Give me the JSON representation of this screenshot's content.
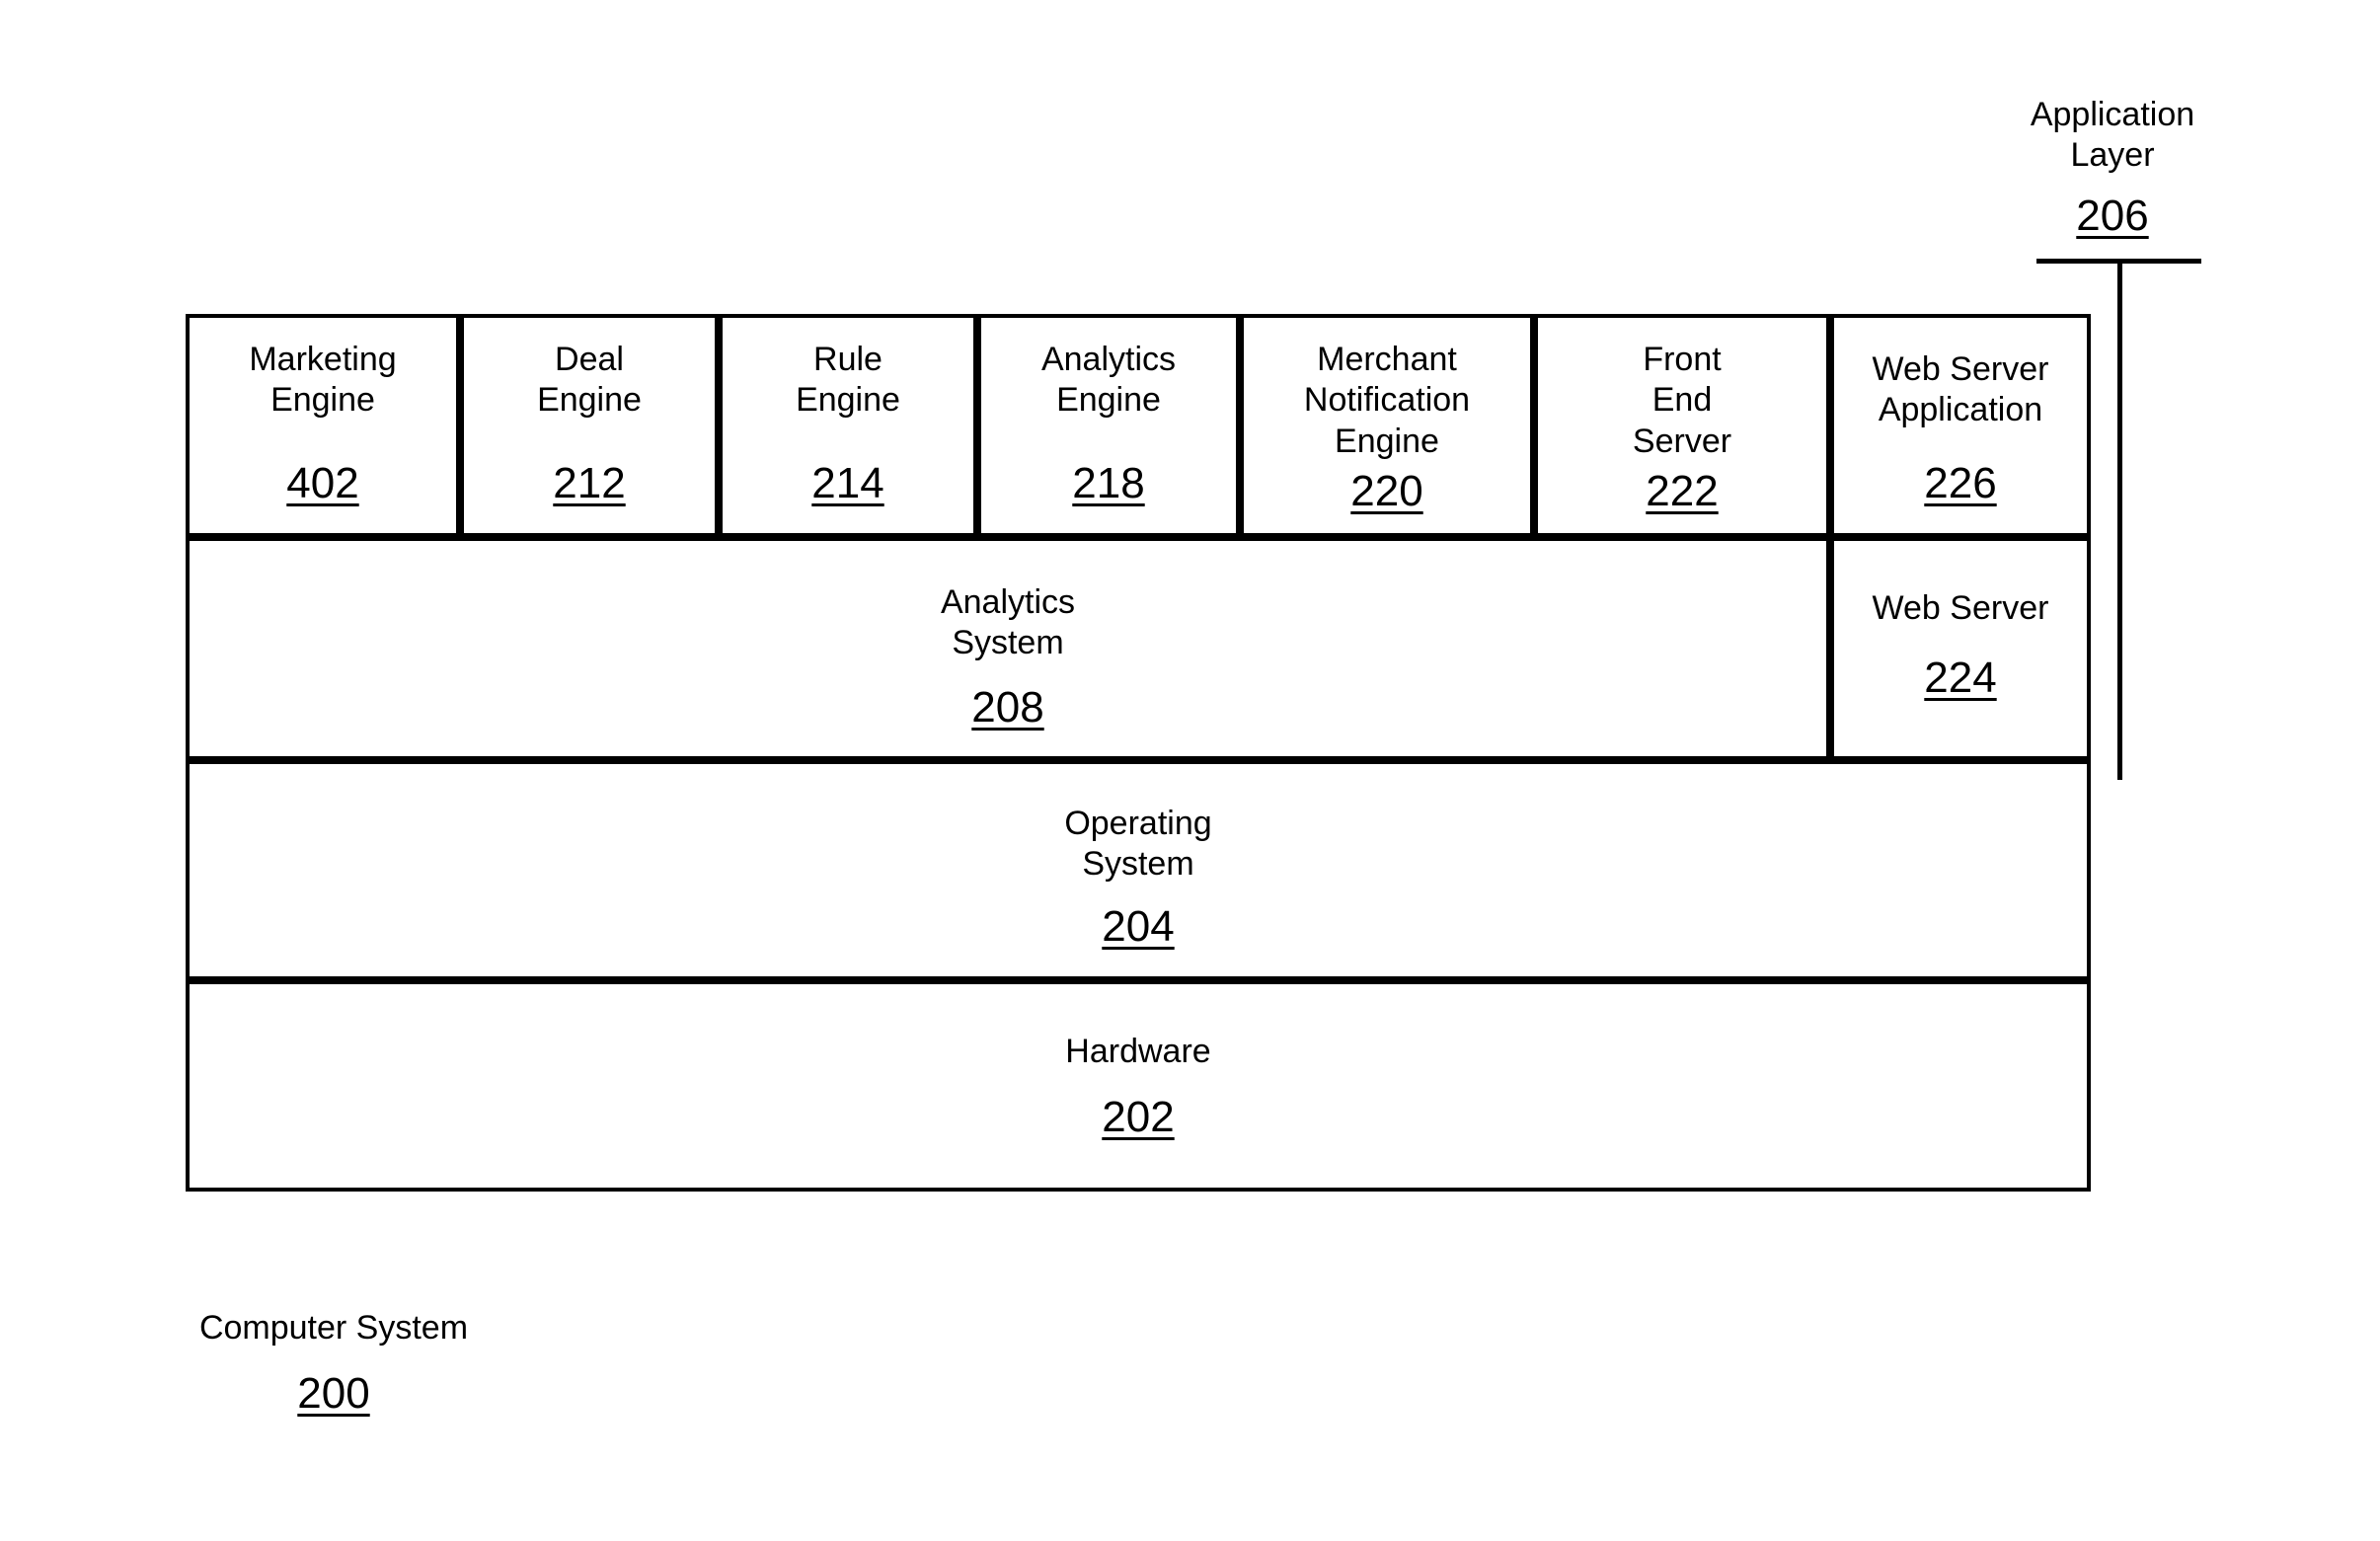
{
  "figure": {
    "title": "Computer System architecture layer diagram",
    "line_color": "#000000",
    "background_color": "#ffffff"
  },
  "application_layer_callout": {
    "label": "Application\nLayer",
    "reference": "206"
  },
  "application_row": {
    "boxes": [
      {
        "label": "Marketing\nEngine",
        "reference": "402"
      },
      {
        "label": "Deal\nEngine",
        "reference": "212"
      },
      {
        "label": "Rule\nEngine",
        "reference": "214"
      },
      {
        "label": "Analytics\nEngine",
        "reference": "218"
      },
      {
        "label": "Merchant\nNotification\nEngine",
        "reference": "220"
      },
      {
        "label": "Front\nEnd\nServer",
        "reference": "222"
      },
      {
        "label": "Web Server\nApplication",
        "reference": "226"
      }
    ]
  },
  "system_row": {
    "analytics_system": {
      "label": "Analytics\nSystem",
      "reference": "208"
    },
    "web_server": {
      "label": "Web Server",
      "reference": "224"
    }
  },
  "operating_system_row": {
    "label": "Operating\nSystem",
    "reference": "204"
  },
  "hardware_row": {
    "label": "Hardware",
    "reference": "202"
  },
  "computer_system_callout": {
    "label": "Computer System",
    "reference": "200"
  }
}
